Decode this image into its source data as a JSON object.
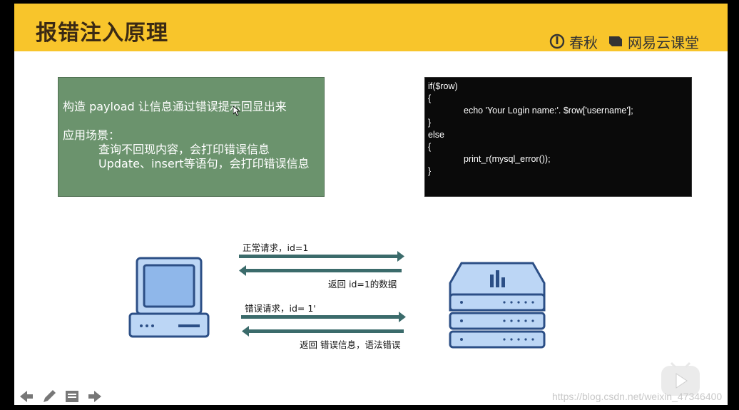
{
  "header": {
    "title": "报错注入原理",
    "brand_chunqiu": "春秋",
    "brand_netease": "网易云课堂"
  },
  "intro_box": {
    "line1": "构造 payload 让信息通过错误提示回显出来",
    "scenarios_label": "应用场景：",
    "scenario1": "查询不回现内容，会打印错误信息",
    "scenario2": "Update、insert等语句，会打印错误信息"
  },
  "code": {
    "lines": [
      "if($row)",
      "{",
      "echo 'Your Login name:'. $row['username'];",
      "}",
      "else",
      "{",
      "print_r(mysql_error());",
      "}"
    ]
  },
  "diagram": {
    "req_normal": "正常请求，id=1",
    "resp_normal": "返回 id=1的数据",
    "req_error": "错误请求，id= 1'",
    "resp_error": "返回 错误信息，语法错误"
  },
  "watermark": "https://blog.csdn.net/weixin_47346400",
  "colors": {
    "header": "#f8c52b",
    "green_box": "#6b936d",
    "arrow": "#3b6b6b",
    "icon_blue": "#bcd6f5",
    "icon_dark": "#2c4f86"
  }
}
